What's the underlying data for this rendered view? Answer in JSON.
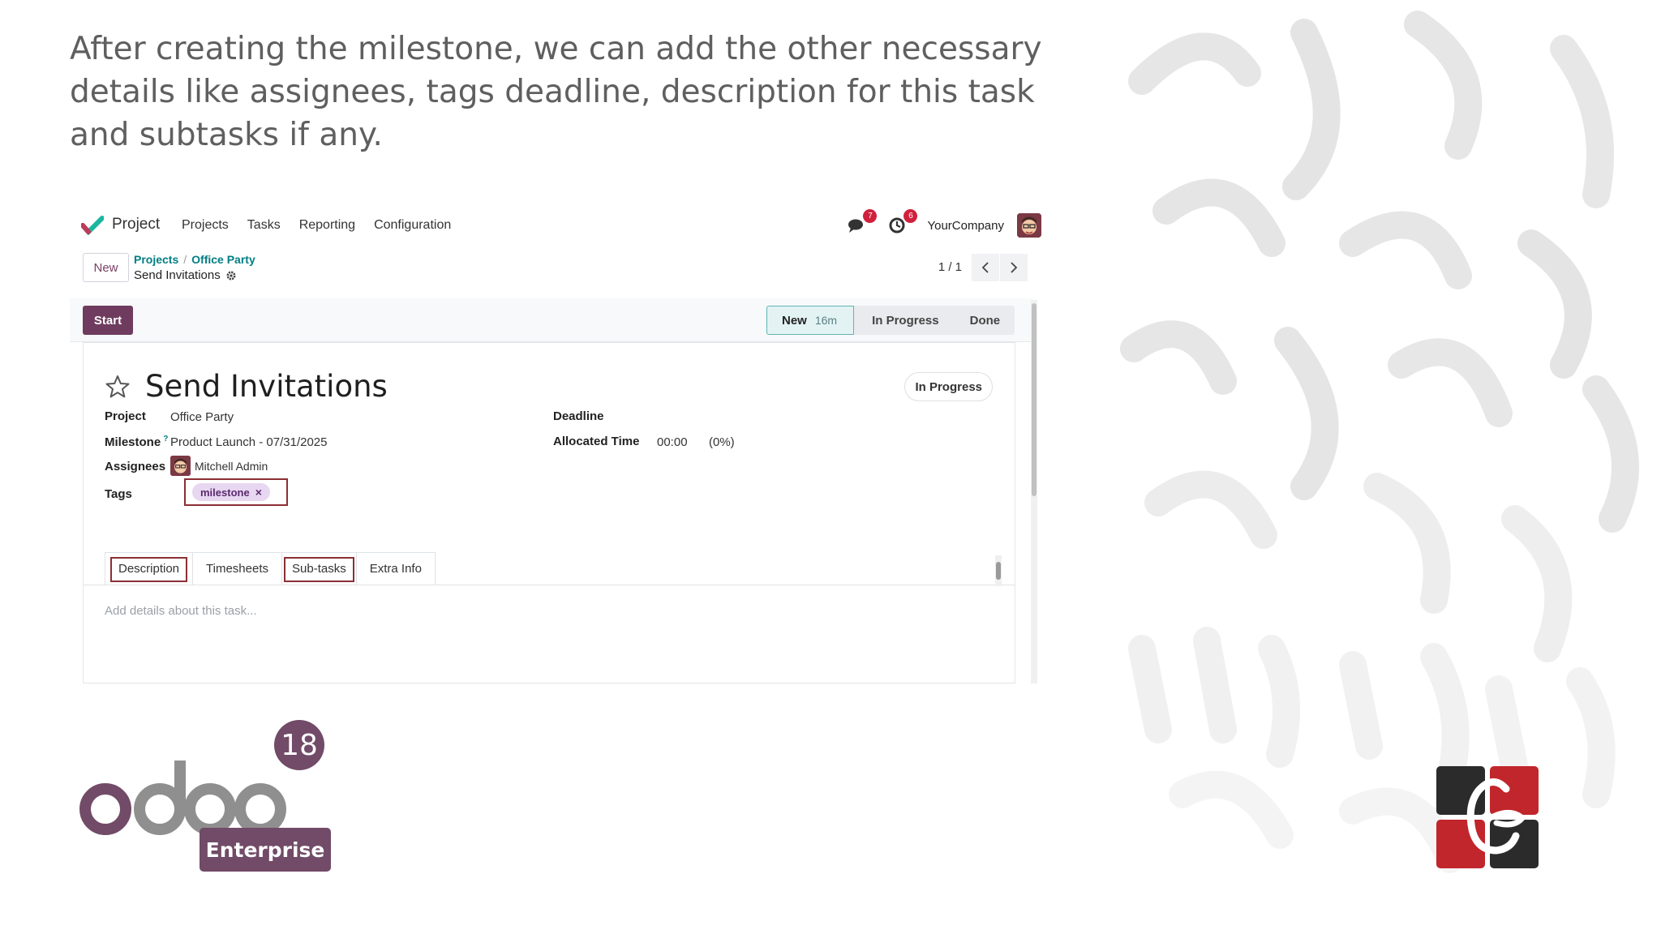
{
  "caption": "After creating the milestone, we can add the other necessary details like assignees, tags deadline, description for this task and subtasks if any.",
  "navbar": {
    "app_name": "Project",
    "menu": [
      "Projects",
      "Tasks",
      "Reporting",
      "Configuration"
    ],
    "messages_count": "7",
    "activities_count": "6",
    "company": "YourCompany"
  },
  "control_panel": {
    "new_label": "New",
    "breadcrumb": [
      "Projects",
      "Office Party"
    ],
    "breadcrumb_sep": "/",
    "current": "Send Invitations",
    "pager": "1 / 1"
  },
  "statusbar": {
    "start_label": "Start",
    "stages": [
      {
        "label": "New",
        "duration": "16m",
        "active": true
      },
      {
        "label": "In Progress",
        "active": false
      },
      {
        "label": "Done",
        "active": false
      }
    ]
  },
  "task": {
    "title": "Send Invitations",
    "state": "In Progress",
    "fields": {
      "project_label": "Project",
      "project_value": "Office Party",
      "milestone_label": "Milestone",
      "milestone_help": "?",
      "milestone_value": "Product Launch - 07/31/2025",
      "assignees_label": "Assignees",
      "assignee_name": "Mitchell Admin",
      "tags_label": "Tags",
      "tag": "milestone",
      "tag_remove": "×",
      "deadline_label": "Deadline",
      "allocated_label": "Allocated Time",
      "allocated_value": "00:00",
      "allocated_percent": "(0%)"
    },
    "tabs": [
      "Description",
      "Timesheets",
      "Sub-tasks",
      "Extra Info"
    ],
    "highlighted_tabs": [
      "Description",
      "Sub-tasks"
    ],
    "description_placeholder": "Add details about this task..."
  },
  "branding": {
    "odoo_version": "18",
    "edition": "Enterprise",
    "primary_color": "#714b67",
    "odoo_grey": "#8f8f8f",
    "highlight_color": "#8b2f35"
  }
}
